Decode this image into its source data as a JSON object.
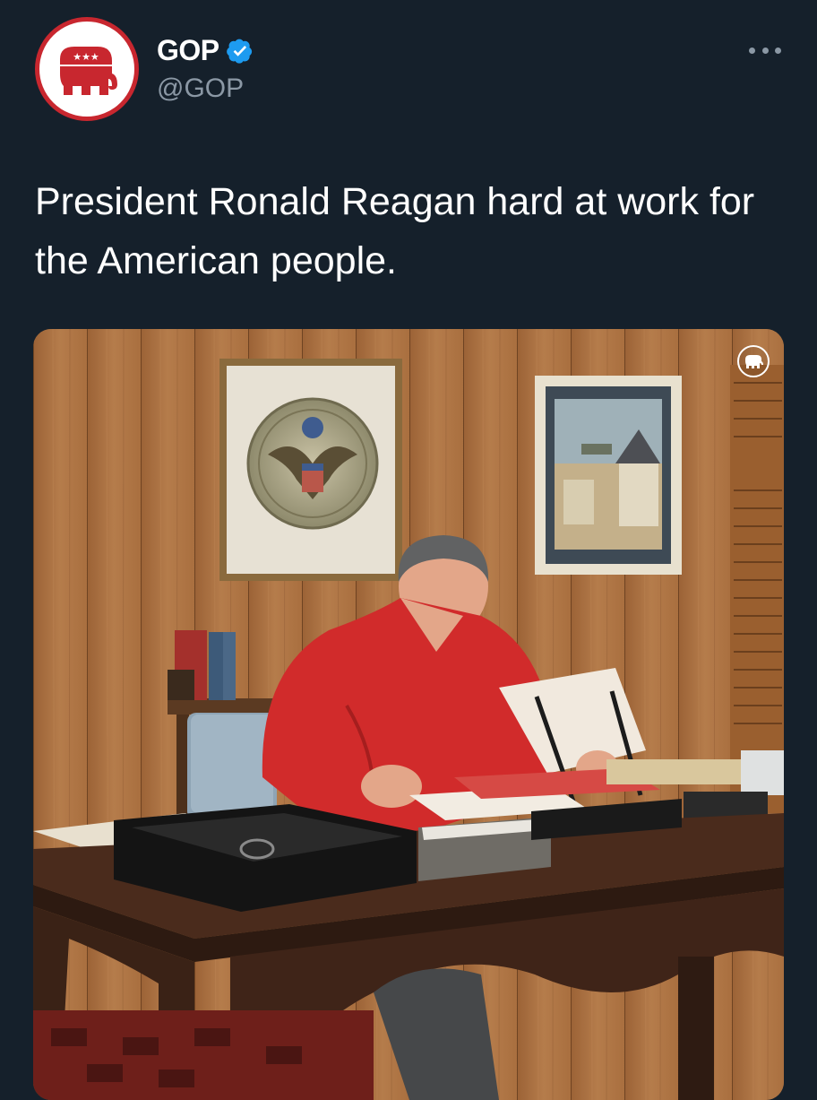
{
  "tweet": {
    "author": {
      "display_name": "GOP",
      "handle": "@GOP",
      "verified": true,
      "avatar_icon": "republican-elephant-logo",
      "avatar_stars": "★★★"
    },
    "text": "President Ronald Reagan hard at work for the American people.",
    "media": {
      "watermark_icon": "republican-elephant-watermark"
    }
  },
  "colors": {
    "background": "#15202b",
    "text_primary": "#ffffff",
    "text_secondary": "#8b98a5",
    "verified": "#1d9bf0",
    "brand_red": "#c8272f"
  },
  "icons": {
    "verified": "verified-badge-icon",
    "more": "more-options-icon"
  }
}
